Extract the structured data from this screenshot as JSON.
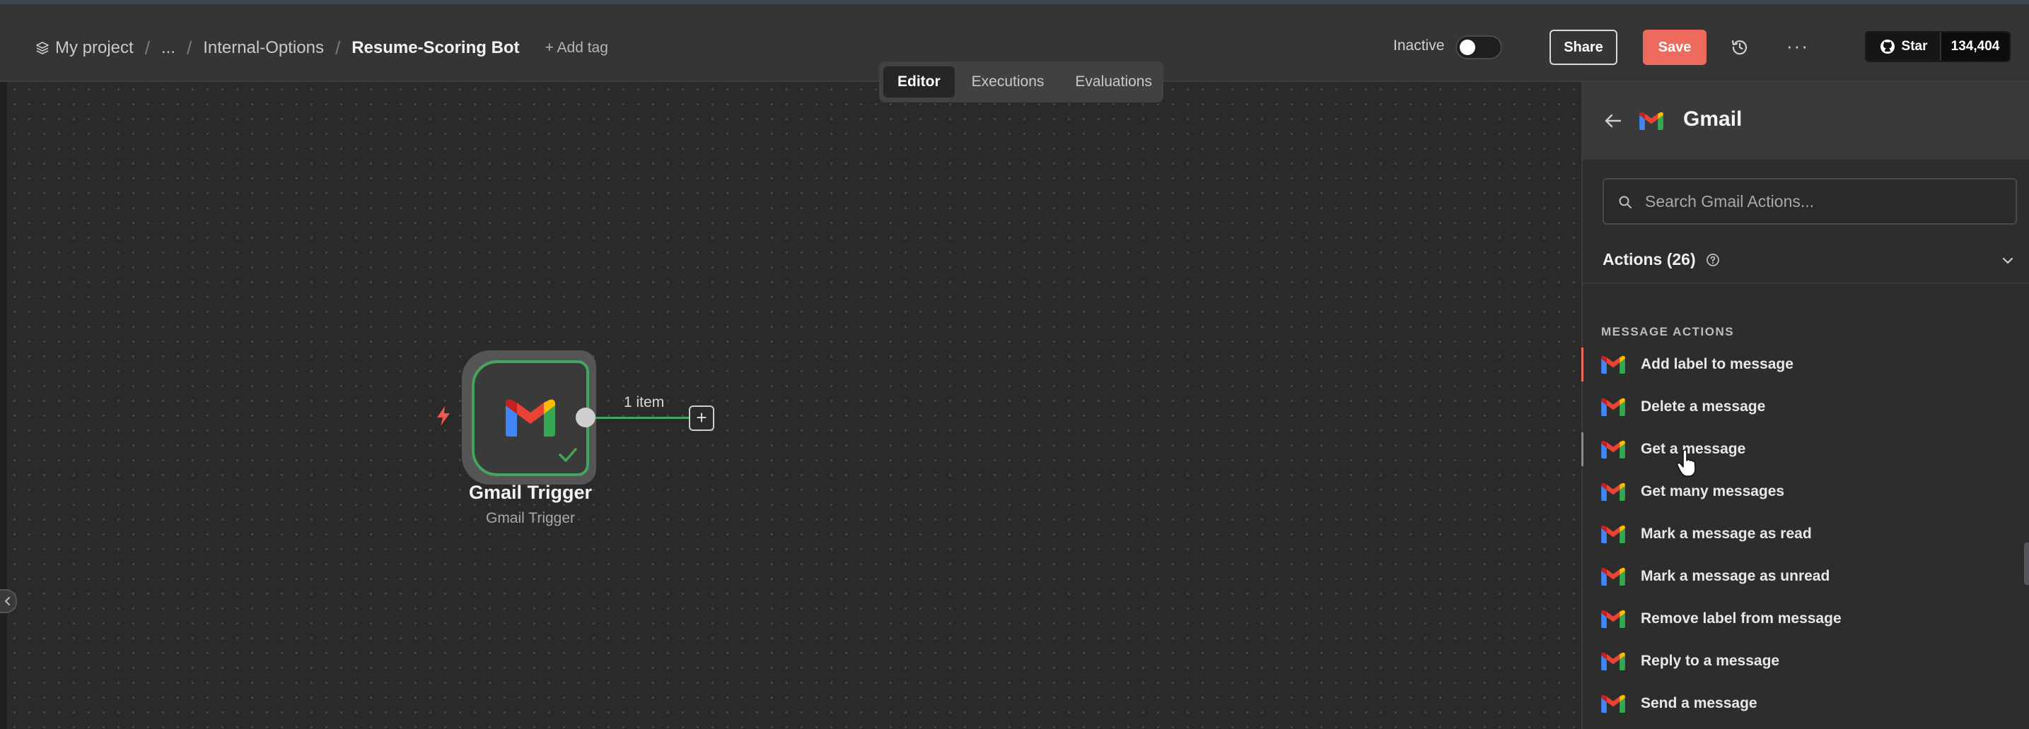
{
  "header": {
    "breadcrumb": {
      "project": "My project",
      "ellipsis": "...",
      "folder": "Internal-Options",
      "workflow": "Resume-Scoring Bot"
    },
    "add_tag": "+ Add tag",
    "tabs": [
      {
        "label": "Editor",
        "active": true
      },
      {
        "label": "Executions",
        "active": false
      },
      {
        "label": "Evaluations",
        "active": false
      }
    ],
    "active_state_label": "Inactive",
    "active_toggle_on": false,
    "share_label": "Share",
    "save_label": "Save",
    "more_label": "···",
    "github": {
      "label": "Star",
      "count": "134,404"
    }
  },
  "canvas": {
    "node": {
      "title": "Gmail Trigger",
      "subtitle": "Gmail Trigger",
      "status": "success"
    },
    "edge_label": "1 item",
    "add_node_label": "+"
  },
  "panel": {
    "title": "Gmail",
    "search_placeholder": "Search Gmail Actions...",
    "actions_title": "Actions (26)",
    "section_label": "MESSAGE ACTIONS",
    "actions": [
      {
        "label": "Add label to message"
      },
      {
        "label": "Delete a message"
      },
      {
        "label": "Get a message"
      },
      {
        "label": "Get many messages"
      },
      {
        "label": "Mark a message as read"
      },
      {
        "label": "Mark a message as unread"
      },
      {
        "label": "Remove label from message"
      },
      {
        "label": "Reply to a message"
      },
      {
        "label": "Send a message"
      }
    ]
  },
  "colors": {
    "accent": "#ee6a5d",
    "success": "#46a35e",
    "panel_bg": "#2d2d2e",
    "canvas_bg": "#2a2a2b"
  }
}
